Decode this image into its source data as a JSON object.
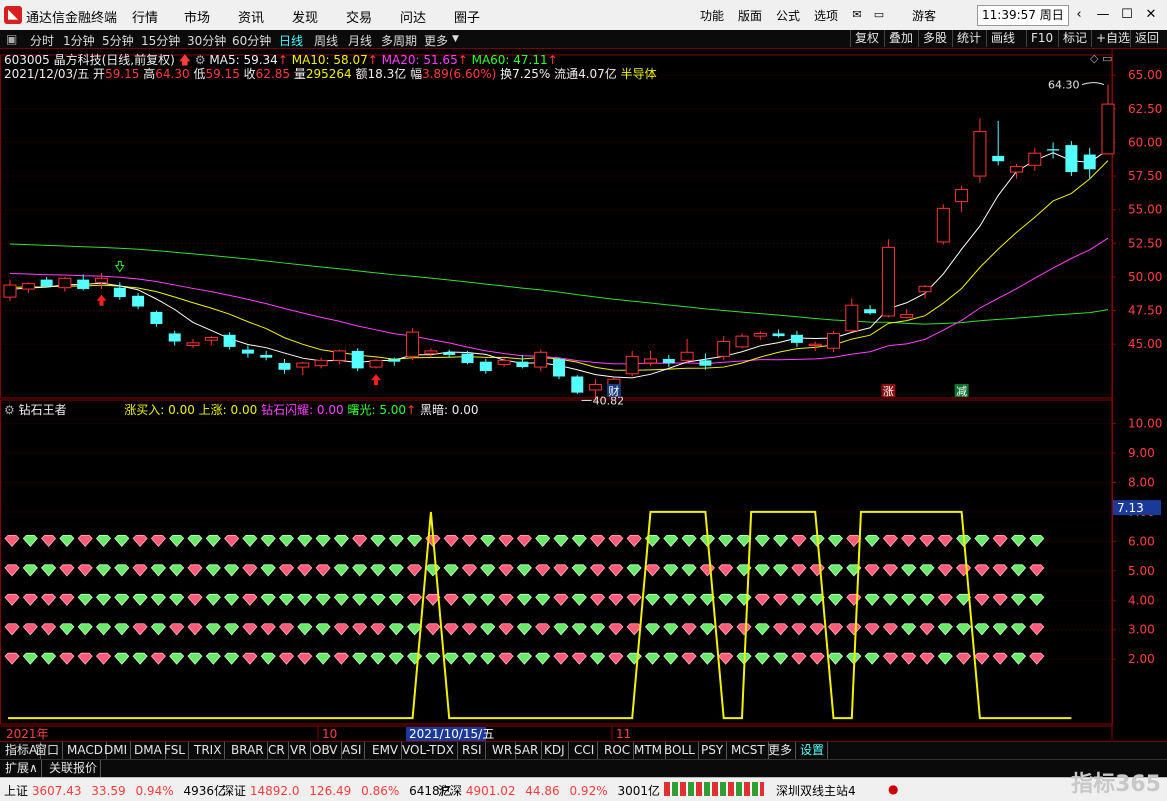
{
  "app": {
    "title": "通达信金融终端",
    "menu": [
      "行情",
      "市场",
      "资讯",
      "发现",
      "交易",
      "问达",
      "圈子"
    ],
    "right_menu": [
      "功能",
      "版面",
      "公式",
      "选项"
    ],
    "guest": "游客",
    "clock": "11:39:57 周日"
  },
  "period_tabs": [
    "分时",
    "1分钟",
    "5分钟",
    "15分钟",
    "30分钟",
    "60分钟",
    "日线",
    "周线",
    "月线",
    "多周期",
    "更多"
  ],
  "toolbar": [
    "复权",
    "叠加",
    "多股",
    "统计",
    "画线",
    "F10",
    "标记",
    "+自选",
    "返回"
  ],
  "stock": {
    "code_name": "603005 晶方科技(日线,前复权)",
    "ma5": "MA5: 59.34",
    "ma10": "MA10: 58.07",
    "ma20": "MA20: 51.65",
    "ma60": "MA60: 47.11",
    "date": "2021/12/03/五",
    "open_label": "开",
    "open": "59.15",
    "high_label": "高",
    "high": "64.30",
    "low_label": "低",
    "low": "59.15",
    "close_label": "收",
    "close": "62.85",
    "vol_label": "量",
    "vol": "295264",
    "amount": "额18.3亿",
    "change_label": "幅",
    "change": "3.89(6.60%)",
    "turnover": "换7.25%",
    "float": "流通4.07亿",
    "sector": "半导体"
  },
  "indicator": {
    "name": "钻石王者",
    "items": [
      "涨买入: 0.00",
      "上涨: 0.00",
      "钻石闪耀: 0.00",
      "曙光: 5.00",
      "黑暗: 0.00"
    ],
    "current_value": "7.13"
  },
  "chart_data": {
    "type": "candlestick",
    "price_axis": {
      "ticks": [
        "65.00",
        "62.50",
        "60.00",
        "57.50",
        "55.00",
        "52.50",
        "50.00",
        "47.50",
        "45.00"
      ],
      "ylim": [
        41.0,
        66.5
      ]
    },
    "candles": [
      [
        48.5,
        49.8,
        48.2,
        49.4
      ],
      [
        49.1,
        49.6,
        48.8,
        49.5
      ],
      [
        49.8,
        50.0,
        49.2,
        49.3
      ],
      [
        49.2,
        50.0,
        48.9,
        49.9
      ],
      [
        49.8,
        50.2,
        49.0,
        49.1
      ],
      [
        49.6,
        50.3,
        49.1,
        49.9
      ],
      [
        49.2,
        49.6,
        48.3,
        48.5
      ],
      [
        48.6,
        48.8,
        47.6,
        47.8
      ],
      [
        47.4,
        47.5,
        46.3,
        46.5
      ],
      [
        45.8,
        46.0,
        44.9,
        45.2
      ],
      [
        44.9,
        45.4,
        44.7,
        45.1
      ],
      [
        45.3,
        45.6,
        44.9,
        45.5
      ],
      [
        45.7,
        45.9,
        44.6,
        44.8
      ],
      [
        44.6,
        44.9,
        44.0,
        44.3
      ],
      [
        44.2,
        44.5,
        43.8,
        44.0
      ],
      [
        43.6,
        43.9,
        42.8,
        43.1
      ],
      [
        43.3,
        43.7,
        42.7,
        43.6
      ],
      [
        43.4,
        44.0,
        43.2,
        43.8
      ],
      [
        43.8,
        44.6,
        43.5,
        44.5
      ],
      [
        44.5,
        44.7,
        43.0,
        43.2
      ],
      [
        43.3,
        43.9,
        43.2,
        43.8
      ],
      [
        43.9,
        44.0,
        43.4,
        43.7
      ],
      [
        44.1,
        46.2,
        43.8,
        45.9
      ],
      [
        44.3,
        44.7,
        44.0,
        44.5
      ],
      [
        44.4,
        44.6,
        44.0,
        44.2
      ],
      [
        44.3,
        44.5,
        43.5,
        43.6
      ],
      [
        43.7,
        43.9,
        42.8,
        43.0
      ],
      [
        43.5,
        44.0,
        43.3,
        43.8
      ],
      [
        43.7,
        44.2,
        43.2,
        43.3
      ],
      [
        43.3,
        44.6,
        43.0,
        44.4
      ],
      [
        43.9,
        44.0,
        42.4,
        42.6
      ],
      [
        42.6,
        42.7,
        41.3,
        41.4
      ],
      [
        41.6,
        42.4,
        40.8,
        42.0
      ],
      [
        41.8,
        42.5,
        41.4,
        42.4
      ],
      [
        42.8,
        44.5,
        42.6,
        44.1
      ],
      [
        43.6,
        44.5,
        43.4,
        43.9
      ],
      [
        43.9,
        44.2,
        43.3,
        43.6
      ],
      [
        43.8,
        45.4,
        43.6,
        44.4
      ],
      [
        43.8,
        44.3,
        43.1,
        43.4
      ],
      [
        44.1,
        45.6,
        43.8,
        45.2
      ],
      [
        44.8,
        45.8,
        44.7,
        45.6
      ],
      [
        45.6,
        46.0,
        45.3,
        45.8
      ],
      [
        45.8,
        46.1,
        45.5,
        45.6
      ],
      [
        45.7,
        46.0,
        44.8,
        45.1
      ],
      [
        44.9,
        45.2,
        44.5,
        45.0
      ],
      [
        44.7,
        46.0,
        44.4,
        45.8
      ],
      [
        46.0,
        48.4,
        45.9,
        47.9
      ],
      [
        47.6,
        47.9,
        47.2,
        47.3
      ],
      [
        47.1,
        52.8,
        47.0,
        52.2
      ],
      [
        47.0,
        47.6,
        46.9,
        47.2
      ],
      [
        48.9,
        49.4,
        48.4,
        49.3
      ],
      [
        52.6,
        55.4,
        52.4,
        55.1
      ],
      [
        55.6,
        56.8,
        54.8,
        56.5
      ],
      [
        57.5,
        61.8,
        57.0,
        60.8
      ],
      [
        59.0,
        61.6,
        58.3,
        58.6
      ],
      [
        57.8,
        58.4,
        57.3,
        58.2
      ],
      [
        58.3,
        59.6,
        57.9,
        59.2
      ],
      [
        59.5,
        60.0,
        58.8,
        59.4
      ],
      [
        59.8,
        60.1,
        57.5,
        57.8
      ],
      [
        59.1,
        59.6,
        57.3,
        58.0
      ],
      [
        59.15,
        64.3,
        59.15,
        62.85
      ]
    ],
    "annotations": {
      "high": "64.30",
      "low": "40.82",
      "tag_cai": "财",
      "tag_zhang": "涨",
      "tag_jian": "减"
    },
    "ind_axis": {
      "ticks": [
        "10.00",
        "9.00",
        "8.00",
        "7.00",
        "6.00",
        "5.00",
        "4.00",
        "3.00",
        "2.00"
      ],
      "ylim": [
        -0.2,
        10.8
      ]
    },
    "ind_segments": [
      [
        0,
        0
      ],
      [
        22,
        0
      ],
      [
        23,
        7
      ],
      [
        24,
        0
      ],
      [
        34,
        0
      ],
      [
        35,
        7
      ],
      [
        38,
        7
      ],
      [
        39,
        0
      ],
      [
        40,
        0
      ],
      [
        40.5,
        7
      ],
      [
        44,
        7
      ],
      [
        45,
        0
      ],
      [
        46,
        0
      ],
      [
        46.5,
        7
      ],
      [
        52,
        7
      ],
      [
        53,
        0
      ],
      [
        58,
        0
      ]
    ],
    "diamonds_red_ratio": 0.42,
    "x_labels": [
      "2021年",
      "10",
      "2021/10/15/五",
      "11"
    ]
  },
  "indicator_tabs": [
    "指标A",
    "窗口",
    "MACD",
    "DMI",
    "DMA",
    "FSL",
    "TRIX",
    "BRAR",
    "CR",
    "VR",
    "OBV",
    "ASI",
    "EMV",
    "VOL-TDX",
    "RSI",
    "WR",
    "SAR",
    "KDJ",
    "CCI",
    "ROC",
    "MTM",
    "BOLL",
    "PSY",
    "MCST",
    "更多",
    "设置"
  ],
  "expand": [
    "扩展∧",
    "关联报价"
  ],
  "status": {
    "sh_label": "上证",
    "sh_value": "3607.43",
    "sh_change": "33.59",
    "sh_pct": "0.94%",
    "sh_amount": "4936亿",
    "sz_label": "深证",
    "sz_value": "14892.0",
    "sz_change": "126.49",
    "sz_pct": "0.86%",
    "sz_amount": "6418亿",
    "hs_label": "沪深",
    "hs_value": "4901.02",
    "hs_change": "44.86",
    "hs_pct": "0.92%",
    "hs_amount": "3001亿",
    "site": "深圳双线主站4"
  },
  "watermark": "指标365",
  "colors": {
    "up": "#ff3333",
    "down": "#54ffff",
    "ma5": "#ffffff",
    "ma10": "#f2f200",
    "ma20": "#ff40ff",
    "ma60": "#30e030",
    "line": "#f2f200"
  }
}
